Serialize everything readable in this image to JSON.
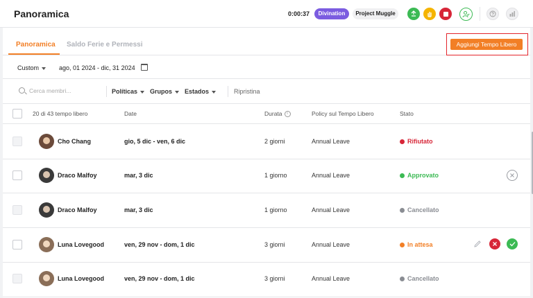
{
  "header": {
    "title": "Panoramica",
    "timer": "0:00:37",
    "project_tag": "Divination",
    "project_name": "Project Muggle"
  },
  "tabs": [
    {
      "label": "Panoramica",
      "active": true
    },
    {
      "label": "Saldo Ferie e Permessi",
      "active": false
    }
  ],
  "add_button": "Aggiungi Tempo Libero",
  "date_filter": {
    "preset": "Custom",
    "range": "ago, 01 2024 - dic, 31 2024"
  },
  "filters": {
    "search_placeholder": "Cerca membri...",
    "policies": "Políticas",
    "groups": "Grupos",
    "states": "Estados",
    "reset": "Ripristina"
  },
  "table": {
    "columns": {
      "count": "20 di 43 tempo libero",
      "date": "Date",
      "duration": "Durata",
      "policy": "Policy sul Tempo Libero",
      "status": "Stato"
    },
    "rows": [
      {
        "name": "Cho Chang",
        "dates": "gio, 5 dic - ven, 6 dic",
        "duration": "2 giorni",
        "policy": "Annual Leave",
        "status": "Rifiutato",
        "status_color": "#d72638",
        "avatar_color": "#6b4a3a"
      },
      {
        "name": "Draco Malfoy",
        "dates": "mar, 3 dic",
        "duration": "1 giorno",
        "policy": "Annual Leave",
        "status": "Approvato",
        "status_color": "#3cba54",
        "avatar_color": "#3a3a3a"
      },
      {
        "name": "Draco Malfoy",
        "dates": "mar, 3 dic",
        "duration": "1 giorno",
        "policy": "Annual Leave",
        "status": "Cancellato",
        "status_color": "#8a8d93",
        "avatar_color": "#3a3a3a"
      },
      {
        "name": "Luna Lovegood",
        "dates": "ven, 29 nov - dom, 1 dic",
        "duration": "3 giorni",
        "policy": "Annual Leave",
        "status": "In attesa",
        "status_color": "#f27f26",
        "avatar_color": "#8a6e58"
      },
      {
        "name": "Luna Lovegood",
        "dates": "ven, 29 nov - dom, 1 dic",
        "duration": "3 giorni",
        "policy": "Annual Leave",
        "status": "Cancellato",
        "status_color": "#8a8d93",
        "avatar_color": "#8a6e58"
      }
    ]
  },
  "colors": {
    "accent": "#f27f26",
    "divination": "#7b5ce0",
    "approved": "#3cba54",
    "rejected": "#d72638",
    "cancelled": "#8a8d93"
  },
  "icons": [
    "caret-down-icon",
    "calendar-icon",
    "search-icon",
    "info-icon",
    "edit-icon",
    "reject-icon",
    "approve-icon",
    "cancel-circle-icon",
    "help-icon",
    "stats-icon",
    "user-check-icon"
  ]
}
